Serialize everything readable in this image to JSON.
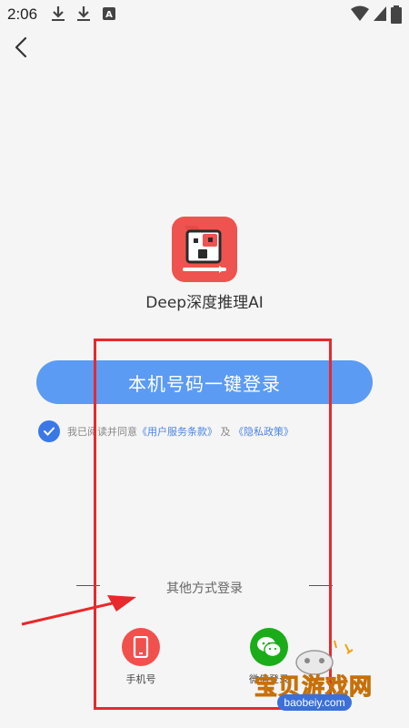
{
  "status_bar": {
    "time": "2:06"
  },
  "app": {
    "name": "Deep深度推理AI"
  },
  "login": {
    "primary_button": "本机号码一键登录",
    "agreement_prefix": "我已阅读并同意",
    "terms_link": "《用户服务条款》",
    "conjunction": "及",
    "privacy_link": "《隐私政策》",
    "agreement_checked": true
  },
  "other_methods": {
    "title": "其他方式登录",
    "phone_label": "手机号",
    "wechat_label": "微信登录"
  },
  "watermark": {
    "text": "宝贝游戏网",
    "url": "baobeiy.com"
  },
  "colors": {
    "primary": "#5b9bf3",
    "phone_red": "#f2504d",
    "wechat_green": "#1aad19",
    "annotation_red": "#e8292b"
  }
}
